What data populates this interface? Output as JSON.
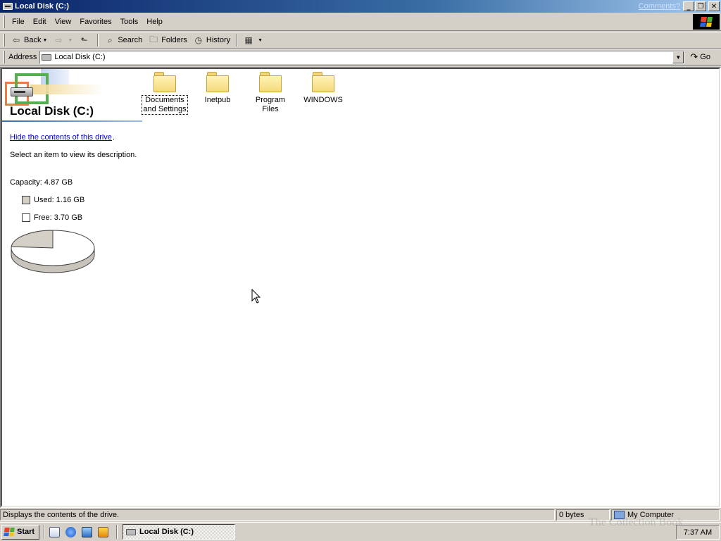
{
  "window": {
    "title": "Local Disk (C:)",
    "comments_link": "Comments?",
    "minimize": "_",
    "restore": "❐",
    "close": "✕"
  },
  "menu": {
    "items": [
      "File",
      "Edit",
      "View",
      "Favorites",
      "Tools",
      "Help"
    ]
  },
  "toolbar": {
    "back": "Back",
    "search": "Search",
    "folders": "Folders",
    "history": "History"
  },
  "address": {
    "label": "Address",
    "value": "Local Disk (C:)",
    "go": "Go"
  },
  "panel": {
    "title": "Local Disk (C:)",
    "hide_link": "Hide the contents of this drive",
    "hide_link_suffix": ".",
    "description": "Select an item to view its description.",
    "capacity": "Capacity: 4.87 GB",
    "used": "Used: 1.16 GB",
    "free": "Free: 3.70 GB",
    "used_color": "#d4d0c8",
    "free_color": "#ffffff",
    "used_fraction": 0.238
  },
  "folders": [
    {
      "label_line1": "Documents",
      "label_line2": "and Settings",
      "selected": true
    },
    {
      "label_line1": "Inetpub",
      "label_line2": "",
      "selected": false
    },
    {
      "label_line1": "Program Files",
      "label_line2": "",
      "selected": false
    },
    {
      "label_line1": "WINDOWS",
      "label_line2": "",
      "selected": false
    }
  ],
  "status": {
    "message": "Displays the contents of the drive.",
    "size": "0 bytes",
    "zone": "My Computer"
  },
  "taskbar": {
    "start": "Start",
    "task": "Local Disk (C:)",
    "clock": "7:37 AM"
  },
  "watermark": "The Collection Book"
}
